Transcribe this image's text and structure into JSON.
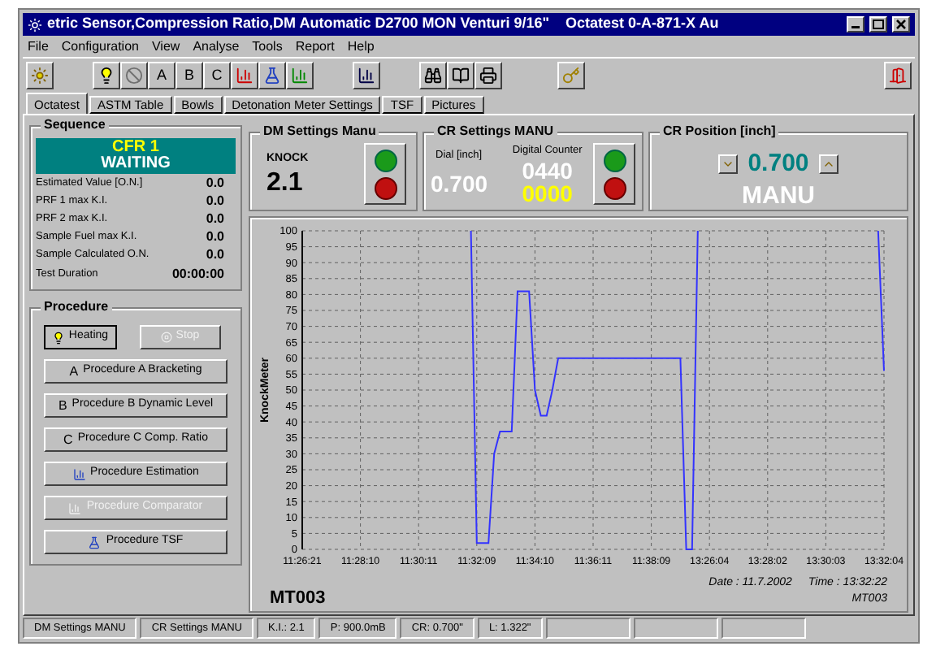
{
  "window": {
    "title": "etric Sensor,Compression Ratio,DM Automatic D2700 MON Venturi 9/16\"    Octatest 0-A-871-X Au"
  },
  "menu": [
    "File",
    "Configuration",
    "View",
    "Analyse",
    "Tools",
    "Report",
    "Help"
  ],
  "toolbar": {
    "letters": [
      "A",
      "B",
      "C"
    ]
  },
  "tabs": [
    {
      "label": "Octatest",
      "selected": true
    },
    {
      "label": "ASTM Table",
      "selected": false
    },
    {
      "label": "Bowls",
      "selected": false
    },
    {
      "label": "Detonation Meter Settings",
      "selected": false
    },
    {
      "label": "TSF",
      "selected": false
    },
    {
      "label": "Pictures",
      "selected": false
    }
  ],
  "sequence": {
    "title": "Sequence",
    "banner_line_1": "CFR 1",
    "banner_line_2": "WAITING",
    "rows": [
      {
        "label": "Estimated Value [O.N.]",
        "value": "0.0"
      },
      {
        "label": "PRF 1 max K.I.",
        "value": "0.0"
      },
      {
        "label": "PRF 2 max K.I.",
        "value": "0.0"
      },
      {
        "label": "Sample Fuel max K.I.",
        "value": "0.0"
      },
      {
        "label": "Sample Calculated O.N.",
        "value": "0.0"
      }
    ],
    "duration_label": "Test Duration",
    "duration": "00:00:00"
  },
  "procedure": {
    "title": "Procedure",
    "heating": {
      "label": "Heating",
      "disabled": false
    },
    "stop": {
      "label": "Stop",
      "disabled": true
    },
    "buttons": [
      {
        "kind": "letter",
        "letter": "A",
        "label": "Procedure A Bracketing",
        "disabled": false
      },
      {
        "kind": "letter",
        "letter": "B",
        "label": "Procedure B Dynamic Level",
        "disabled": false
      },
      {
        "kind": "letter",
        "letter": "C",
        "label": "Procedure C  Comp. Ratio",
        "disabled": false
      },
      {
        "kind": "icon",
        "label": "Procedure  Estimation",
        "disabled": false
      },
      {
        "kind": "icon",
        "label": "Procedure Comparator",
        "disabled": true
      },
      {
        "kind": "icon",
        "label": "Procedure  TSF",
        "disabled": false
      }
    ]
  },
  "dm_settings": {
    "title": "DM Settings Manu",
    "label": "KNOCK",
    "value": "2.1"
  },
  "cr_settings": {
    "title": "CR Settings MANU",
    "dial_label": "Dial [inch]",
    "dial": "0.700",
    "counter_label": "Digital Counter",
    "counter": "0440",
    "counter_2": "0000"
  },
  "cr_position": {
    "title": "CR Position [inch]",
    "value": "0.700",
    "mode": "MANU"
  },
  "chart": {
    "chart_data": {
      "type": "line",
      "ylabel": "KnockMeter",
      "categories": [
        "11:26:21",
        null,
        null,
        null,
        null,
        null,
        null,
        null,
        null,
        null,
        "11:28:10",
        null,
        null,
        null,
        null,
        null,
        null,
        null,
        null,
        null,
        "11:30:11",
        null,
        null,
        null,
        null,
        null,
        null,
        null,
        null,
        null,
        "11:32:09",
        null,
        null,
        null,
        null,
        null,
        null,
        null,
        null,
        null,
        "11:34:10",
        null,
        null,
        null,
        null,
        null,
        null,
        null,
        null,
        null,
        "11:36:11",
        null,
        null,
        null,
        null,
        null,
        null,
        null,
        null,
        null,
        "11:38:09",
        null,
        null,
        null,
        null,
        null,
        null,
        null,
        null,
        null,
        "13:26:04",
        null,
        null,
        null,
        null,
        null,
        null,
        null,
        null,
        null,
        "13:28:02",
        null,
        null,
        null,
        null,
        null,
        null,
        null,
        null,
        null,
        "13:30:03",
        null,
        null,
        null,
        null,
        null,
        null,
        null,
        null,
        null,
        "13:32:04"
      ],
      "series": [
        {
          "color": "#3333ff",
          "values": [
            null,
            null,
            null,
            null,
            null,
            null,
            null,
            null,
            null,
            null,
            null,
            null,
            null,
            null,
            null,
            null,
            null,
            null,
            null,
            null,
            null,
            null,
            null,
            null,
            null,
            null,
            null,
            null,
            null,
            100,
            2,
            2,
            2,
            30,
            37,
            37,
            37,
            81,
            81,
            81,
            50,
            42,
            42,
            50,
            60,
            60,
            60,
            60,
            60,
            60,
            60,
            60,
            60,
            60,
            60,
            60,
            60,
            60,
            60,
            60,
            60,
            60,
            60,
            60,
            60,
            60,
            0,
            0,
            100,
            null,
            null,
            null,
            null,
            null,
            null,
            null,
            null,
            null,
            null,
            null,
            null,
            null,
            null,
            null,
            null,
            null,
            null,
            null,
            null,
            null,
            null,
            null,
            null,
            null,
            null,
            null,
            null,
            null,
            null,
            100,
            56
          ]
        }
      ],
      "ylim": [
        0,
        100
      ],
      "grid": true,
      "yticks": [
        0,
        5,
        10,
        15,
        20,
        25,
        30,
        35,
        40,
        45,
        50,
        55,
        60,
        65,
        70,
        75,
        80,
        85,
        90,
        95,
        100
      ]
    },
    "engine": "MT003",
    "date": "Date : 11.7.2002",
    "time": "Time : 13:32:22",
    "engine_small": "MT003"
  },
  "status_bar": [
    "DM Settings MANU",
    "CR Settings MANU",
    "K.I.: 2.1",
    "P: 900.0mB",
    "CR: 0.700\"",
    "L: 1.322\""
  ]
}
